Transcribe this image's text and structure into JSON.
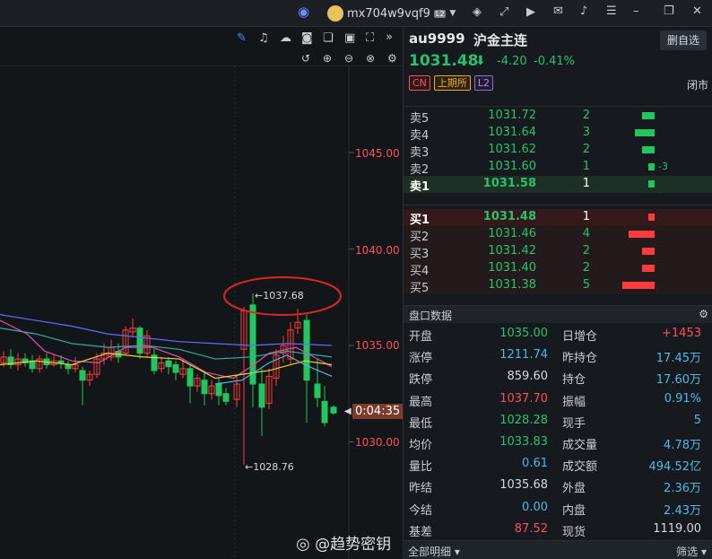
{
  "topbar": {
    "username": "mx704w9vqf9",
    "level_badge": "L2"
  },
  "chart": {
    "y_ticks": [
      "1045.00",
      "1040.00",
      "1035.00",
      "1030.00"
    ],
    "high_label": "←1037.68",
    "low_label": "←1028.76",
    "countdown": "0:04:35"
  },
  "quote": {
    "code": "au9999",
    "name": "沪金主连",
    "delete_label": "删自选",
    "price": "1031.48",
    "change": "-4.20",
    "change_pct": "-0.41%",
    "tags": [
      "CN",
      "上期所",
      "L2"
    ],
    "status": "闭市",
    "asks": [
      {
        "label": "卖5",
        "price": "1031.72",
        "vol": "2",
        "bar": 0.4
      },
      {
        "label": "卖4",
        "price": "1031.64",
        "vol": "3",
        "bar": 0.6
      },
      {
        "label": "卖3",
        "price": "1031.62",
        "vol": "2",
        "bar": 0.4
      },
      {
        "label": "卖2",
        "price": "1031.60",
        "vol": "1",
        "bar": 0.2,
        "delta": "-3"
      },
      {
        "label": "卖1",
        "price": "1031.58",
        "vol": "1",
        "bar": 0.2
      }
    ],
    "bids": [
      {
        "label": "买1",
        "price": "1031.48",
        "vol": "1",
        "bar": 0.2
      },
      {
        "label": "买2",
        "price": "1031.46",
        "vol": "4",
        "bar": 0.8
      },
      {
        "label": "买3",
        "price": "1031.42",
        "vol": "2",
        "bar": 0.4
      },
      {
        "label": "买4",
        "price": "1031.40",
        "vol": "2",
        "bar": 0.4
      },
      {
        "label": "买5",
        "price": "1031.38",
        "vol": "5",
        "bar": 1.0
      }
    ],
    "panel_title": "盘口数据",
    "stats_left": [
      {
        "k": "开盘",
        "v": "1035.00",
        "c": "#27c26f"
      },
      {
        "k": "涨停",
        "v": "1211.74",
        "c": "#4fb8e6"
      },
      {
        "k": "跌停",
        "v": "859.60",
        "c": "#d6d9dd"
      },
      {
        "k": "最高",
        "v": "1037.70",
        "c": "#ff4d5a"
      },
      {
        "k": "最低",
        "v": "1028.28",
        "c": "#27c26f"
      },
      {
        "k": "均价",
        "v": "1033.83",
        "c": "#27c26f"
      },
      {
        "k": "量比",
        "v": "0.61",
        "c": "#4fb8e6"
      },
      {
        "k": "昨结",
        "v": "1035.68",
        "c": "#d6d9dd"
      },
      {
        "k": "今结",
        "v": "0.00",
        "c": "#4fb8e6"
      },
      {
        "k": "基差",
        "v": "87.52",
        "c": "#ff4d5a"
      }
    ],
    "stats_right": [
      {
        "k": "日增仓",
        "v": "+1453",
        "c": "#ff4d5a"
      },
      {
        "k": "昨持仓",
        "v": "17.45万",
        "c": "#4fb8e6"
      },
      {
        "k": "持仓",
        "v": "17.60万",
        "c": "#4fb8e6"
      },
      {
        "k": "振幅",
        "v": "0.91%",
        "c": "#4fb8e6"
      },
      {
        "k": "现手",
        "v": "5",
        "c": "#4fb8e6"
      },
      {
        "k": "成交量",
        "v": "4.78万",
        "c": "#4fb8e6"
      },
      {
        "k": "成交额",
        "v": "494.52亿",
        "c": "#4fb8e6"
      },
      {
        "k": "外盘",
        "v": "2.36万",
        "c": "#4fb8e6"
      },
      {
        "k": "内盘",
        "v": "2.43万",
        "c": "#4fb8e6"
      },
      {
        "k": "现货",
        "v": "1119.00",
        "c": "#d6d9dd"
      }
    ],
    "footer_left": "全部明细 ▾",
    "footer_right": "筛选 ▾"
  },
  "watermark": "@趋势密钥",
  "colors": {
    "up": "#ff3b3b",
    "down": "#22c55e",
    "bg": "#131619"
  }
}
